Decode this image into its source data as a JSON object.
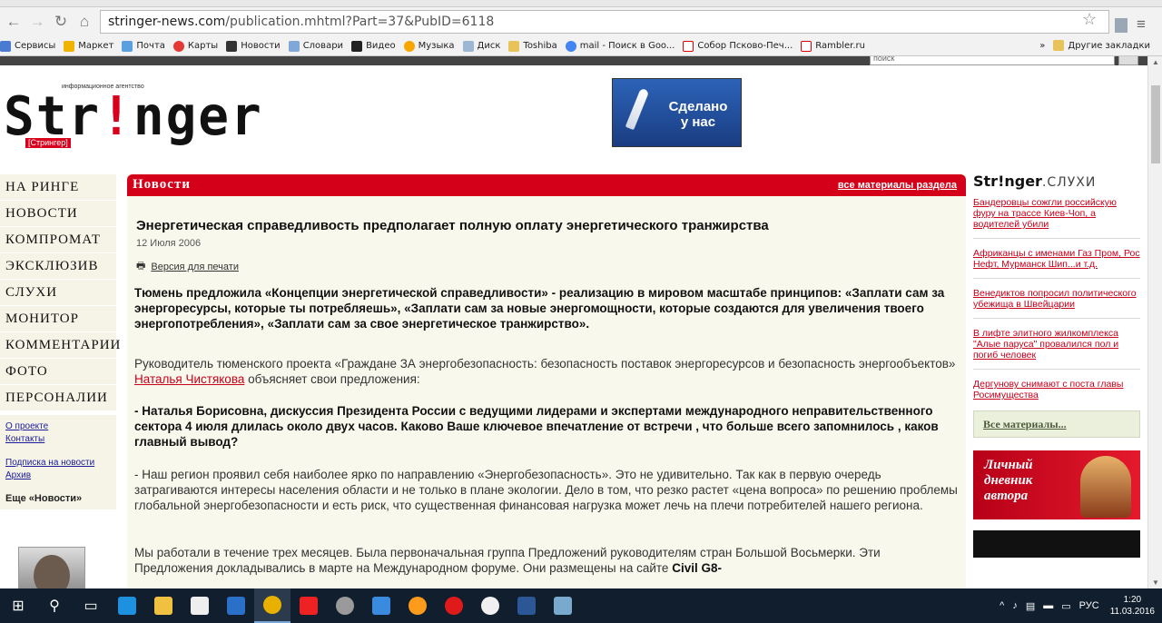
{
  "browser": {
    "url_host": "stringer-news.com",
    "url_path": "/publication.mhtml?Part=37&PubID=6118",
    "bookmarks": [
      "Сервисы",
      "Маркет",
      "Почта",
      "Карты",
      "Новости",
      "Словари",
      "Видео",
      "Музыка",
      "Диск",
      "Toshiba",
      "mail - Поиск в Goo...",
      "Собор Псково-Печ...",
      "Rambler.ru"
    ],
    "bookmarks_more": "»",
    "other_bookmarks": "Другие закладки"
  },
  "site": {
    "logo_small": "информационное агентство",
    "logo_main": "Str",
    "logo_i": "!",
    "logo_end": "nger",
    "logo_sub": "[Стрингер]",
    "banner_line1": "Сделано",
    "banner_line2": "у нас",
    "search_placeholder": "поиск"
  },
  "leftnav": {
    "items": [
      "На ринге",
      "Новости",
      "Компромат",
      "Эксклюзив",
      "Слухи",
      "Монитор",
      "Комментарии",
      "Фото",
      "Персоналии"
    ],
    "about": "О проекте",
    "contacts": "Контакты",
    "subscribe": "Подписка на новости",
    "archive": "Архив",
    "more_news": "Еще «Новости»"
  },
  "main": {
    "section": "Новости",
    "all_link": "все материалы раздела",
    "title": "Энергетическая справедливость предполагает полную оплату энергетического транжирства",
    "date": "12 Июля 2006",
    "print": "Версия для печати",
    "lead": "Тюмень предложила «Концепции энергетической справедливости» - реализацию в мировом масштабе принципов: «Заплати сам за энергоресурсы, которые ты потребляешь», «Заплати сам за новые энергомощности, которые создаются для увеличения твоего энергопотребления», «Заплати сам за свое энергетическое транжирство».",
    "p1_start": "Руководитель тюменского проекта «Граждане ЗА энергобезопасность: безопасность поставок энергоресурсов и безопасность энергообъектов»",
    "p1_link": "Наталья Чистякова",
    "p1_end": "объясняет свои предложения:",
    "q1": "- Наталья Борисовна, дискуссия Президента России с ведущими лидерами и экспертами международного неправительственного сектора 4 июля длилась около двух часов. Каково Ваше ключевое впечатление от встречи , что больше всего запомнилось , каков главный вывод?",
    "p2": "- Наш регион проявил себя наиболее ярко по направлению «Энергобезопасность». Это не удивительно. Так как в первую очередь затрагиваются интересы населения области и не только в плане экологии. Дело в том, что резко растет «цена вопроса» по решению проблемы глобальной энергобезопасности и есть риск, что существенная финансовая нагрузка может лечь на плечи потребителей нашего региона.",
    "p3": "Мы работали в течение трех месяцев. Была первоначальная группа Предложений руководителям стран Большой Восьмерки. Эти Предложения докладывались в марте на Международном форуме. Они размещены на сайте",
    "p3_bold": "Civil G8-"
  },
  "right": {
    "logo_main": "Str!nger",
    "logo_s": ".СЛУХИ",
    "items": [
      "Бандеровцы сожгли российскую фуру на трассе Киев-Чоп, а водителей убили",
      "Африканцы с именами Газ Пром, Рос Нефт, Мурманск Шип...и т.д.",
      "Венедиктов попросил политического убежища в Швейцарии",
      "В лифте элитного жилкомплекса \"Алые паруса\" провалился пол и погиб человек",
      "Дергунову снимают с поста главы Росимущества"
    ],
    "all": "Все материалы...",
    "diary_1": "Личный",
    "diary_2": "дневник",
    "diary_3": "автора"
  },
  "taskbar": {
    "lang": "РУС",
    "time": "1:20",
    "date": "11.03.2016"
  }
}
